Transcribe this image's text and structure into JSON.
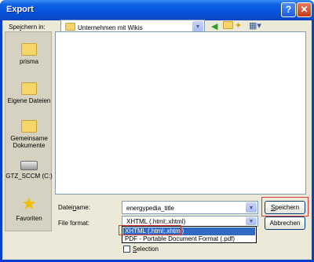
{
  "window": {
    "title": "Export"
  },
  "titlebar": {
    "help_label": "?",
    "close_label": "✕"
  },
  "save_in": {
    "label_pre": "Spe",
    "label_u": "i",
    "label_post": "chern in:",
    "value": "Unternehmen mit Wikis"
  },
  "places": [
    {
      "label": "prisma",
      "icon": "folder"
    },
    {
      "label": "Eigene Dateien",
      "icon": "folder"
    },
    {
      "label": "Gemeinsame Dokumente",
      "icon": "folder"
    },
    {
      "label": "GTZ_SCCM (C:)",
      "icon": "drive"
    },
    {
      "label": "Favoriten",
      "icon": "star"
    }
  ],
  "filename": {
    "label_pre": "Datei",
    "label_u": "n",
    "label_post": "ame:",
    "value": "energypedia_title"
  },
  "fileformat": {
    "label": "File format:",
    "value": "XHTML (.html;.xhtml)",
    "options": [
      "XHTML (.html;.xhtml)",
      "PDF - Portable Document Format (.pdf)"
    ],
    "selected_index": 0
  },
  "buttons": {
    "save_pre": "",
    "save_u": "S",
    "save_post": "peichern",
    "cancel": "Abbrechen"
  },
  "selection": {
    "label_u": "S",
    "label_post": "election",
    "checked": false
  },
  "colors": {
    "highlight_border": "#d43a3a",
    "selection_bg": "#316ac5"
  }
}
